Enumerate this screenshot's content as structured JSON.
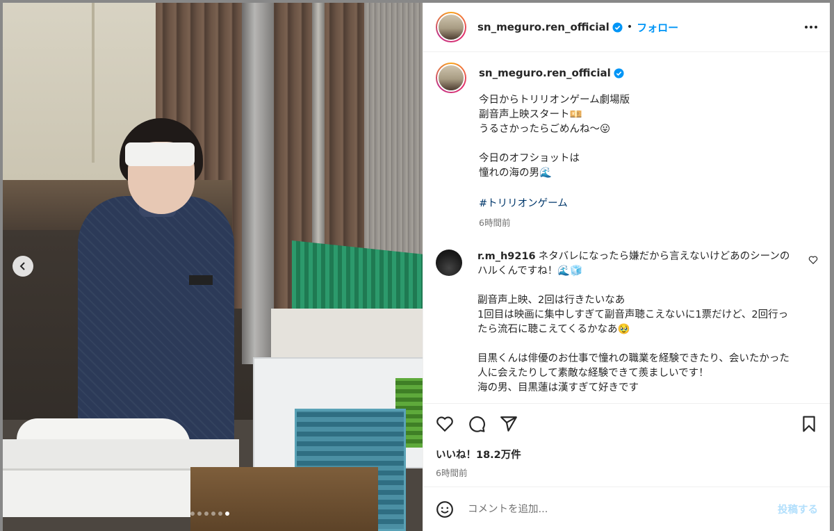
{
  "post": {
    "username": "sn_meguro.ren_official",
    "separator": "•",
    "follow_label": "フォロー",
    "caption": "今日からトリリオンゲーム劇場版\n副音声上映スタート💴\nうるさかったらごめんね〜😛\n\n今日のオフショットは\n憧れの海の男🌊",
    "hashtag": "#トリリオンゲーム",
    "caption_time": "6時間前",
    "likes": "いいね！18.2万件",
    "time": "6時間前"
  },
  "comments": [
    {
      "username": "r.m_h9216",
      "text": "ネタバレになったら嫌だから言えないけどあのシーンのハルくんですね！🌊🧊\n\n副音声上映、2回は行きたいなあ\n1回目は映画に集中しすぎて副音声聴こえないに1票だけど、2回行ったら流石に聴こえてくるかなあ🥹\n\n目黒くんは俳優のお仕事で憧れの職業を経験できたり、会いたかった人に会えたりして素敵な経験できて羨ましいです！\n海の男、目黒蓮は漢すぎて好きです"
    }
  ],
  "composer": {
    "placeholder": "コメントを追加...",
    "post_label": "投稿する"
  },
  "carousel": {
    "count": 6,
    "active_index": 5
  },
  "colors": {
    "link_blue": "#0095f6",
    "hashtag": "#00376b",
    "muted": "#737373"
  }
}
